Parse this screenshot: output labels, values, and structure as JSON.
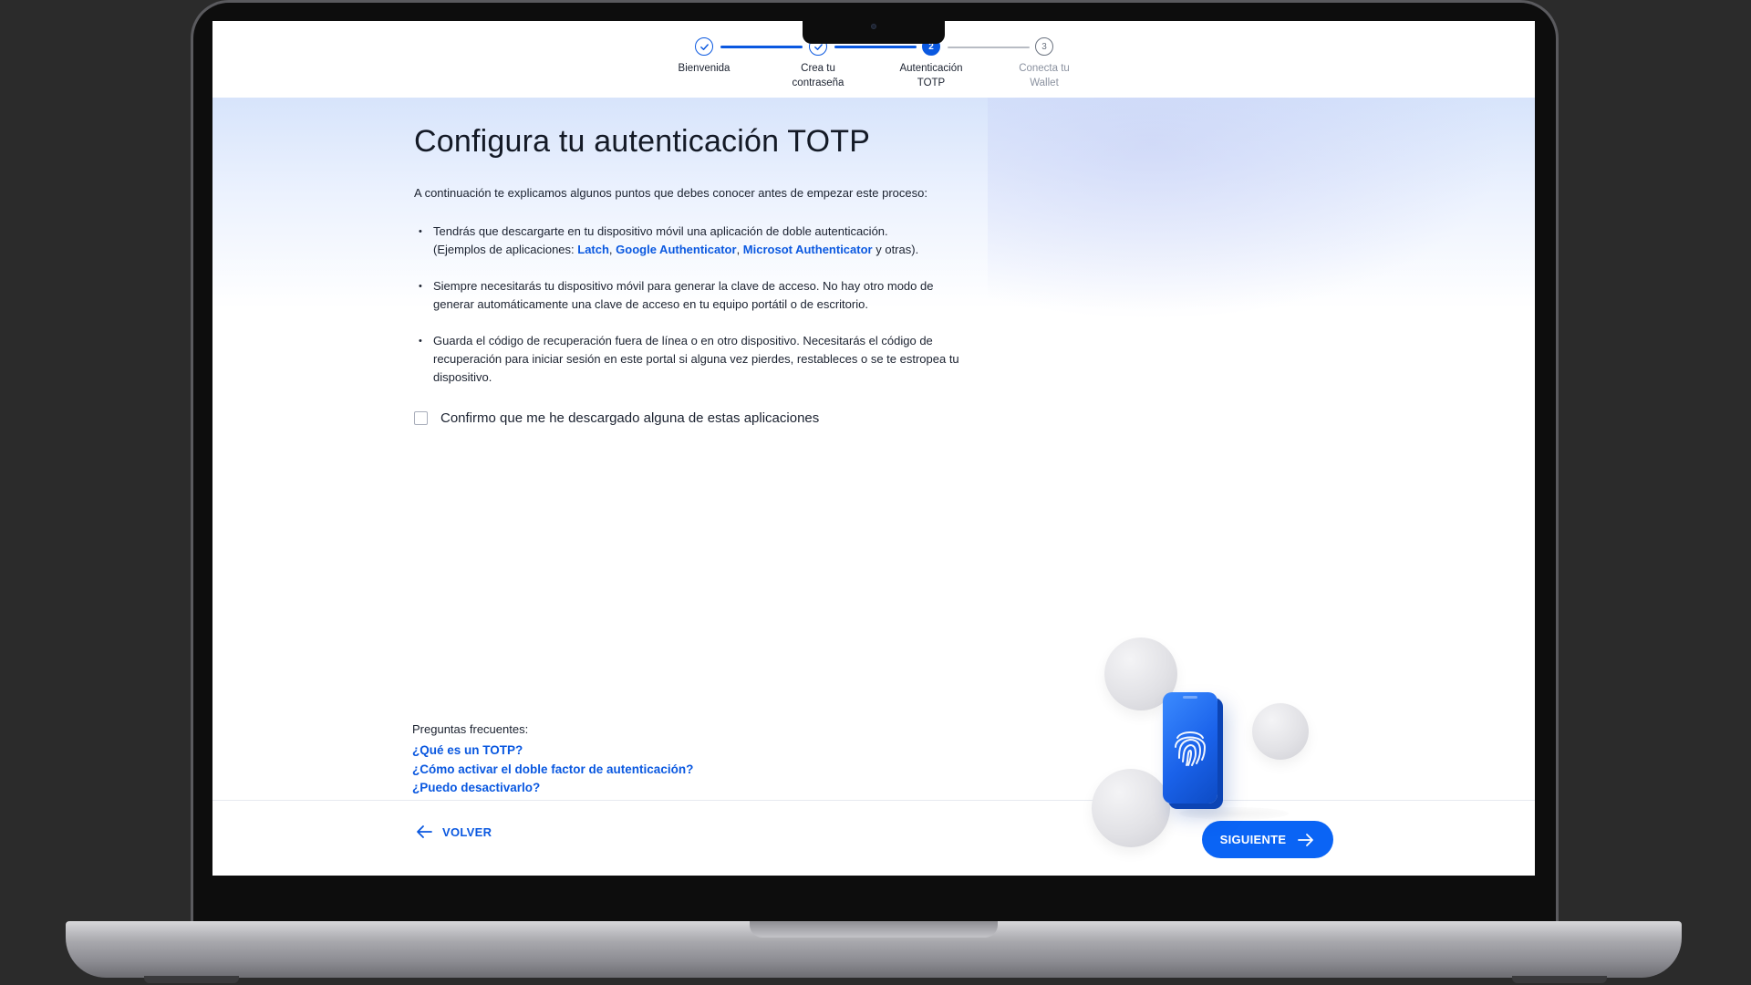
{
  "stepper": {
    "steps": [
      {
        "label_line1": "Bienvenida",
        "label_line2": "",
        "marker": "",
        "state": "completed"
      },
      {
        "label_line1": "Crea tu",
        "label_line2": "contraseña",
        "marker": "",
        "state": "completed"
      },
      {
        "label_line1": "Autenticación",
        "label_line2": "TOTP",
        "marker": "2",
        "state": "active"
      },
      {
        "label_line1": "Conecta tu",
        "label_line2": "Wallet",
        "marker": "3",
        "state": "pending"
      }
    ]
  },
  "main": {
    "title": "Configura tu autenticación TOTP",
    "intro": "A continuación te explicamos algunos puntos que debes conocer antes de empezar este proceso:",
    "bullet1": {
      "line1": "Tendrás que descargarte en tu dispositivo móvil una aplicación de doble autenticación.",
      "prefix": "(Ejemplos de aplicaciones: ",
      "app1": "Latch",
      "sep1": ", ",
      "app2": "Google Authenticator",
      "sep2": ", ",
      "app3": "Microsot Authenticator",
      "suffix": " y otras)."
    },
    "bullet2": "Siempre necesitarás tu dispositivo móvil para generar la clave de acceso. No hay otro modo de generar automáticamente una clave de acceso en tu equipo portátil o de escritorio.",
    "bullet3": "Guarda el código de recuperación fuera de línea o en otro dispositivo. Necesitarás el código de recuperación para iniciar sesión en este portal si alguna vez pierdes, restableces o se te estropea tu dispositivo.",
    "confirm_label": "Confirmo que me he descargado alguna de estas aplicaciones",
    "confirm_checked": false
  },
  "faq": {
    "title": "Preguntas frecuentes:",
    "links": [
      "¿Qué es un TOTP?",
      "¿Cómo activar el doble factor de autenticación?",
      "¿Puedo desactivarlo?"
    ]
  },
  "footer": {
    "back_label": "VOLVER",
    "next_label": "SIGUIENTE"
  },
  "illustration": {
    "icon": "fingerprint-phone-icon"
  },
  "colors": {
    "accent": "#0a58e0",
    "button": "#0a64f5",
    "text": "#1b2230"
  }
}
